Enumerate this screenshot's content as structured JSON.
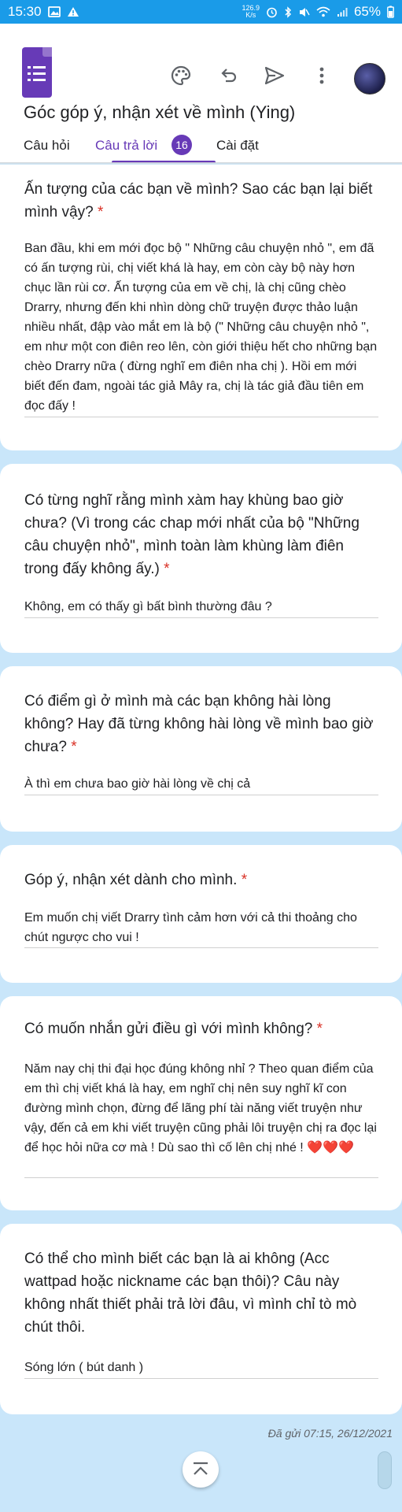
{
  "status": {
    "time": "15:30",
    "speed_value": "126.9",
    "speed_unit": "K/s",
    "battery": "65%"
  },
  "app": {
    "form_title": "Góc góp ý, nhận xét về mình (Ying)",
    "tabs": {
      "questions": "Câu hỏi",
      "responses": "Câu trả lời",
      "responses_count": "16",
      "settings": "Cài đặt"
    },
    "toolbar": {
      "icons": [
        "palette-icon",
        "undo-icon",
        "send-icon",
        "more-vert-icon"
      ]
    }
  },
  "responses": [
    {
      "question": "Ấn tượng của các bạn về mình? Sao các bạn lại biết mình vậy?",
      "required_mark": "*",
      "answer": "Ban đầu, khi em mới đọc bộ \" Những câu chuyện nhỏ \", em đã có ấn tượng rùi, chị viết khá là hay, em còn cày bộ này hơn chục lần rùi cơ. Ấn tượng của em về chị, là chị cũng chèo Drarry, nhưng đến khi nhìn dòng chữ truyện được thảo luận nhiều nhất, đập vào mắt em là bộ (\" Những câu chuyện nhỏ \", em như một con điên reo lên, còn giới thiệu hết cho những bạn chèo Drarry nữa ( đừng nghĩ em điên nha chị ). Hồi em mới biết đến đam, ngoài tác giả Mây ra, chị là tác giả đầu tiên em đọc đấy !"
    },
    {
      "question": "Có từng nghĩ rằng mình xàm hay khùng bao giờ chưa? (Vì trong các chap mới nhất của bộ \"Những câu chuyện nhỏ\", mình toàn làm khùng làm điên trong đấy không ấy.)",
      "required_mark": "*",
      "answer": "Không, em có thấy gì bất bình thường đâu ?"
    },
    {
      "question": "Có điểm gì ở mình mà các bạn không hài lòng không? Hay đã từng không hài lòng về mình bao giờ chưa?",
      "required_mark": "*",
      "answer": "À thì em chưa bao giờ hài lòng về chị cả"
    },
    {
      "question": "Góp ý, nhận xét dành cho mình.",
      "required_mark": "*",
      "answer": "Em muốn chị viết Drarry tình cảm hơn với cả thi thoảng cho chút ngược cho vui !"
    },
    {
      "question": "Có muốn nhắn gửi điều gì với mình không?",
      "required_mark": "*",
      "answer": "Năm nay chị thi đại học đúng không nhỉ ? Theo quan điểm của em thì chị viết khá là hay, em nghĩ chị nên suy nghĩ kĩ con đường mình chọn, đừng để lãng phí tài năng viết truyện như vậy, đến cả em khi viết truyện cũng phải lôi truyện chị ra đọc lại để học hỏi nữa cơ mà ! Dù sao thì cố lên chị nhé ! ❤️❤️❤️"
    },
    {
      "question": "Có thể cho mình biết các bạn là ai không (Acc wattpad hoặc nickname các bạn thôi)? Câu này không nhất thiết phải trả lời đâu, vì mình chỉ tò mò chút thôi.",
      "required_mark": "",
      "answer": "Sóng lớn ( bút danh )"
    }
  ],
  "footer": {
    "submitted": "Đã gửi 07:15, 26/12/2021",
    "fab_icon": "scroll-to-top-icon"
  }
}
